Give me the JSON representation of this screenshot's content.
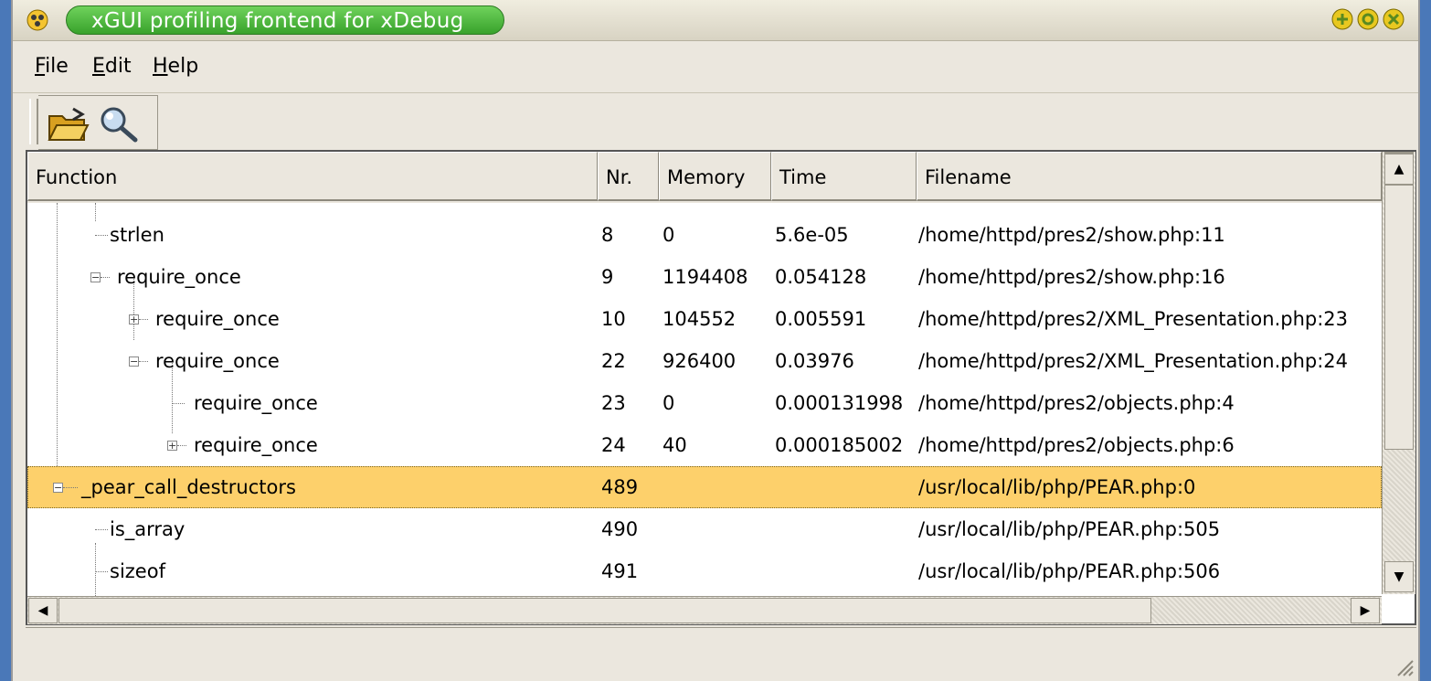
{
  "window": {
    "title": "xGUI profiling frontend for xDebug"
  },
  "menu": [
    {
      "first": "F",
      "rest": "ile"
    },
    {
      "first": "E",
      "rest": "dit"
    },
    {
      "first": "H",
      "rest": "elp"
    }
  ],
  "toolbar": {
    "open_icon": "folder-open-icon",
    "search_icon": "magnifier-icon"
  },
  "columns": {
    "function": "Function",
    "nr": "Nr.",
    "memory": "Memory",
    "time": "Time",
    "filename": "Filename"
  },
  "rows": [
    {
      "function": "strlen",
      "nr": "8",
      "memory": "0",
      "time": "5.6e-05",
      "filename": "/home/httpd/pres2/show.php:11"
    },
    {
      "function": "require_once",
      "nr": "9",
      "memory": "1194408",
      "time": "0.054128",
      "filename": "/home/httpd/pres2/show.php:16"
    },
    {
      "function": "require_once",
      "nr": "10",
      "memory": "104552",
      "time": "0.005591",
      "filename": "/home/httpd/pres2/XML_Presentation.php:23"
    },
    {
      "function": "require_once",
      "nr": "22",
      "memory": "926400",
      "time": "0.03976",
      "filename": "/home/httpd/pres2/XML_Presentation.php:24"
    },
    {
      "function": "require_once",
      "nr": "23",
      "memory": "0",
      "time": "0.000131998",
      "filename": "/home/httpd/pres2/objects.php:4"
    },
    {
      "function": "require_once",
      "nr": "24",
      "memory": "40",
      "time": "0.000185002",
      "filename": "/home/httpd/pres2/objects.php:6"
    },
    {
      "function": "_pear_call_destructors",
      "nr": "489",
      "memory": "",
      "time": "",
      "filename": "/usr/local/lib/php/PEAR.php:0"
    },
    {
      "function": "is_array",
      "nr": "490",
      "memory": "",
      "time": "",
      "filename": "/usr/local/lib/php/PEAR.php:505"
    },
    {
      "function": "sizeof",
      "nr": "491",
      "memory": "",
      "time": "",
      "filename": "/usr/local/lib/php/PEAR.php:506"
    }
  ]
}
